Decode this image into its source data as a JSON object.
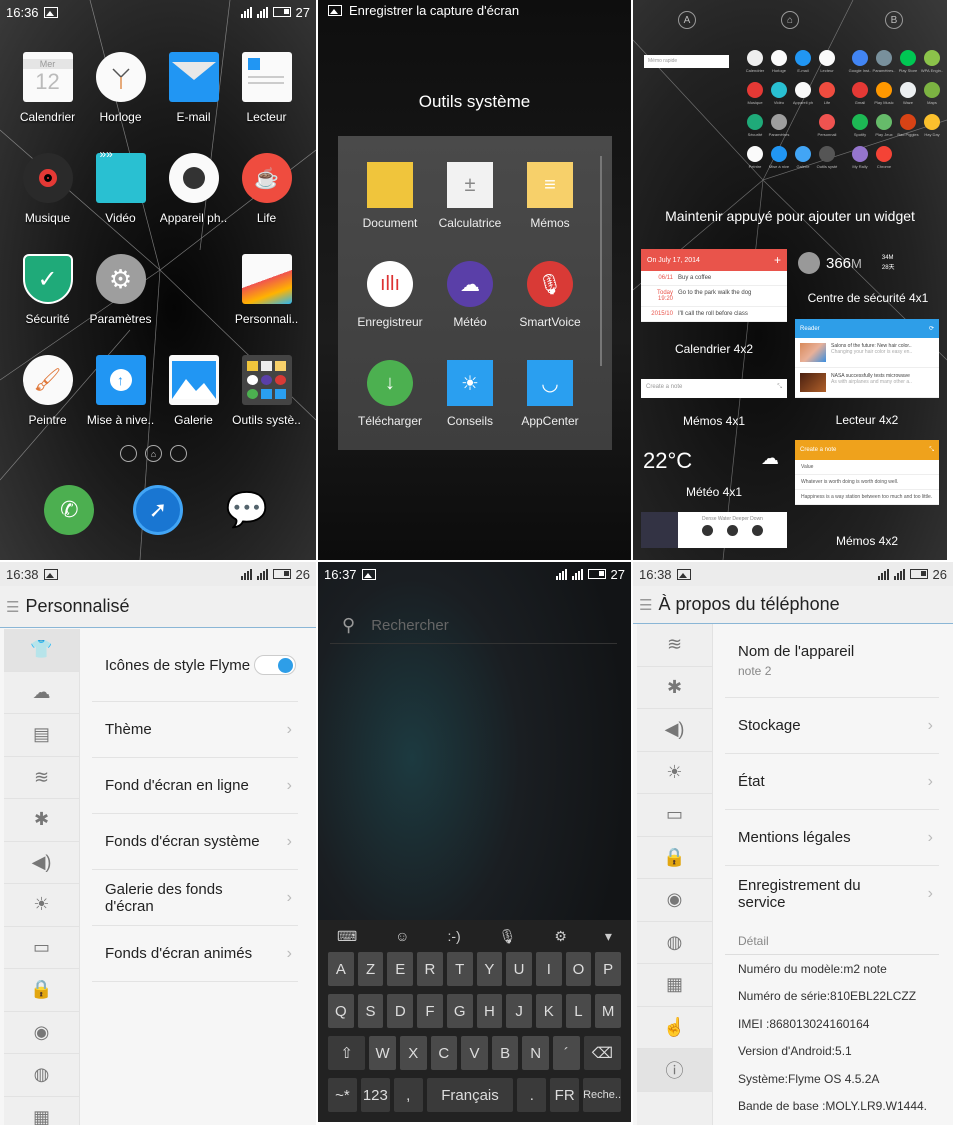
{
  "home": {
    "status": {
      "time": "16:36",
      "battery": "27"
    },
    "apps": [
      {
        "label": "Calendrier",
        "icon": "calendar-icon",
        "day": "Mer",
        "date": "12"
      },
      {
        "label": "Horloge",
        "icon": "clock-icon"
      },
      {
        "label": "E-mail",
        "icon": "mail-icon"
      },
      {
        "label": "Lecteur",
        "icon": "reader-icon"
      },
      {
        "label": "Musique",
        "icon": "music-icon"
      },
      {
        "label": "Vidéo",
        "icon": "video-icon"
      },
      {
        "label": "Appareil ph..",
        "icon": "camera-icon"
      },
      {
        "label": "Life",
        "icon": "cup-icon"
      },
      {
        "label": "Sécurité",
        "icon": "shield-icon"
      },
      {
        "label": "Paramètres",
        "icon": "gear-icon"
      },
      {
        "label": "",
        "icon": ""
      },
      {
        "label": "Personnali..",
        "icon": "personalize-icon"
      },
      {
        "label": "Peintre",
        "icon": "paint-icon"
      },
      {
        "label": "Mise à nive..",
        "icon": "upgrade-icon"
      },
      {
        "label": "Galerie",
        "icon": "gallery-icon"
      },
      {
        "label": "Outils systè..",
        "icon": "folder-icon"
      }
    ],
    "dock": [
      {
        "icon": "phone-icon"
      },
      {
        "icon": "browser-icon"
      },
      {
        "icon": "messages-icon"
      }
    ]
  },
  "folder": {
    "toast": "Enregistrer la capture d'écran",
    "title": "Outils système",
    "apps": [
      {
        "label": "Document",
        "icon": "folder-icon",
        "color": "#f0c53c"
      },
      {
        "label": "Calculatrice",
        "icon": "calculator-icon",
        "color": "#f2f2f2"
      },
      {
        "label": "Mémos",
        "icon": "notes-icon",
        "color": "#f7d06a"
      },
      {
        "label": "Enregistreur",
        "icon": "recorder-icon",
        "color": "#ffffff"
      },
      {
        "label": "Météo",
        "icon": "weather-icon",
        "color": "#5a3fa8"
      },
      {
        "label": "SmartVoice",
        "icon": "microphone-icon",
        "color": "#d93a36"
      },
      {
        "label": "Télécharger",
        "icon": "download-icon",
        "color": "#4cb050"
      },
      {
        "label": "Conseils",
        "icon": "tips-icon",
        "color": "#2a9ff0"
      },
      {
        "label": "AppCenter",
        "icon": "appstore-icon",
        "color": "#2a9ff0"
      }
    ]
  },
  "drawer": {
    "nav": [
      "A",
      "⌂",
      "B"
    ],
    "mini_widget": "Mémo rapide",
    "page_a": [
      "Calendrier",
      "Horloge",
      "E-mail",
      "Lecteur",
      "Musique",
      "Vidéo",
      "Appareil ph",
      "Life",
      "Sécurité",
      "Paramètres",
      "",
      "Personnali",
      "Peintre",
      "Mise à nive",
      "Galerie",
      "Outils systè"
    ],
    "page_b": [
      "Google Inst..",
      "Paramètres..",
      "Play Store",
      "WPA Engin..",
      "Gmail",
      "Play Music",
      "Waze",
      "Maps",
      "Spotify",
      "Play Jeux",
      "Bad Piggies",
      "Hay Day",
      "My Rally",
      "Chrome"
    ],
    "hint": "Maintenir appuyé pour ajouter un widget",
    "calendar_widget": {
      "header": "On July 17, 2014",
      "rows": [
        {
          "date": "06/11",
          "text": "Buy a coffee"
        },
        {
          "date": "Today 19:20",
          "text": "Go to the park walk the dog"
        },
        {
          "date": "2015/10",
          "text": "I'll call the roll before class"
        }
      ],
      "label": "Calendrier 4x2"
    },
    "security_widget": {
      "value": "366",
      "unit": "M",
      "label": "Centre de sécurité 4x1",
      "side1": "34M",
      "side2": "28天"
    },
    "reader_widget": {
      "header": "Reader",
      "items": [
        {
          "title": "Salons of the future: New hair color..",
          "sub": "Changing your hair color is easy en.."
        },
        {
          "title": "NASA successfully tests microwave",
          "sub": "As with airplanes and many other a.."
        }
      ],
      "label": "Lecteur 4x2"
    },
    "memo1_widget": {
      "placeholder": "Create a note",
      "label": "Mémos 4x1"
    },
    "weather_widget": {
      "temp": "22°C",
      "label": "Météo 4x1"
    },
    "music_widget": {
      "title": "Dense Water Deeper Down"
    },
    "memo2_widget": {
      "header": "Create a note",
      "rows": [
        "Value",
        "Whatever is worth doing is worth doing well.",
        "Happiness is a way station between too much and too little."
      ],
      "label": "Mémos 4x2"
    }
  },
  "personalize": {
    "status": {
      "time": "16:38",
      "battery": "26"
    },
    "title": "Personnalisé",
    "side_icons": [
      "shirt-icon",
      "cloud-icon",
      "sim-icon",
      "wifi-icon",
      "bluetooth-icon",
      "volume-icon",
      "brightness-icon",
      "battery-icon",
      "lock-icon",
      "location-icon",
      "globe-icon",
      "apps-icon"
    ],
    "side_glyphs": [
      "👕",
      "☁",
      "▤",
      "≋",
      "✱",
      "◀)",
      "☀",
      "▭",
      "🔒",
      "◉",
      "◍",
      "▦"
    ],
    "items": [
      {
        "label": "Icônes de style Flyme",
        "type": "toggle",
        "value": true
      },
      {
        "label": "Thème",
        "type": "link"
      },
      {
        "label": "Fond d'écran en ligne",
        "type": "link"
      },
      {
        "label": "Fonds d'écran système",
        "type": "link"
      },
      {
        "label": "Galerie des fonds d'écran",
        "type": "link"
      },
      {
        "label": "Fonds d'écran animés",
        "type": "link"
      }
    ]
  },
  "search_screen": {
    "status": {
      "time": "16:37",
      "battery": "27"
    },
    "placeholder": "Rechercher",
    "keyboard": {
      "tools": [
        "⌨",
        "☺",
        ":-)",
        "🎙",
        "⚙",
        "▾"
      ],
      "row1": [
        "A",
        "Z",
        "E",
        "R",
        "T",
        "Y",
        "U",
        "I",
        "O",
        "P"
      ],
      "row2": [
        "Q",
        "S",
        "D",
        "F",
        "G",
        "H",
        "J",
        "K",
        "L",
        "M"
      ],
      "row3": [
        "⇧",
        "W",
        "X",
        "C",
        "V",
        "B",
        "N",
        "´",
        "⌫"
      ],
      "row4": [
        "~*",
        "123",
        ",",
        "Français",
        ".",
        "FR",
        "Reche.."
      ]
    }
  },
  "about": {
    "status": {
      "time": "16:38",
      "battery": "26"
    },
    "title": "À propos du téléphone",
    "side_glyphs": [
      "≋",
      "✱",
      "◀)",
      "☀",
      "▭",
      "🔒",
      "◉",
      "◍",
      "▦",
      "☝",
      "ⓘ"
    ],
    "items": [
      {
        "label": "Nom de l'appareil",
        "sub": "note 2"
      },
      {
        "label": "Stockage"
      },
      {
        "label": "État"
      },
      {
        "label": "Mentions légales"
      },
      {
        "label": "Enregistrement du service"
      }
    ],
    "detail_header": "Détail",
    "details": [
      "Numéro du modèle:m2 note",
      "Numéro de série:810EBL22LCZZ",
      "IMEI :868013024160164",
      "Version d'Android:5.1",
      "Système:Flyme OS 4.5.2A",
      "Bande de base :MOLY.LR9.W1444."
    ]
  }
}
